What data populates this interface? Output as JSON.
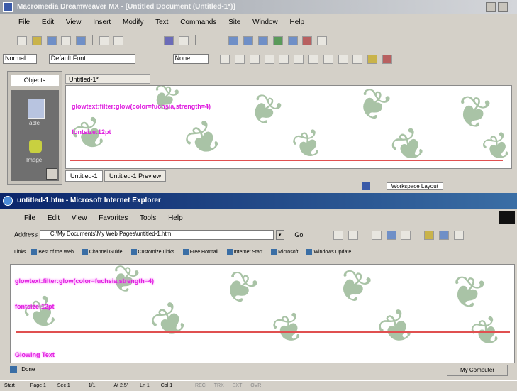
{
  "dw_window": {
    "title": "Macromedia Dreamweaver MX - [Untitled Document (Untitled-1*)]",
    "menu": [
      "File",
      "Edit",
      "View",
      "Insert",
      "Modify",
      "Text",
      "Commands",
      "Site",
      "Window",
      "Help"
    ],
    "properties": {
      "format_value": "Normal",
      "font_value": "Default Font",
      "size_value": "None"
    },
    "doc_tab": "Untitled-1*",
    "panel_label": "Objects",
    "panel_icons": [
      {
        "name": "layout-icon",
        "label": "Table"
      },
      {
        "name": "image-icon",
        "label": "Image"
      }
    ],
    "content_text_1": "glowtext:filter:glow(color=fuchsia,strength=4)",
    "content_text_2": "fontsize:12pt",
    "status_tabs": [
      "Untitled-1",
      "Untitled-1 Preview"
    ],
    "status_right": "Workspace Layout"
  },
  "ie_window": {
    "title": "untitled-1.htm - Microsoft Internet Explorer",
    "menu": [
      "File",
      "Edit",
      "View",
      "Favorites",
      "Tools",
      "Help"
    ],
    "address_label": "Address",
    "address_value": "C:\\My Documents\\My Web Pages\\untitled-1.htm",
    "go_label": "Go",
    "links_label": "Links",
    "links": [
      "Best of the Web",
      "Channel Guide",
      "Customize Links",
      "Free Hotmail",
      "Internet Start",
      "Microsoft",
      "Windows Update"
    ],
    "content_text_1": "glowtext:filter:glow(color=fuchsia,strength=4)",
    "content_text_2": "fontsize:12pt",
    "content_text_3": "Glowing Text",
    "status_left": "Done",
    "status_right": "My Computer"
  },
  "taskbar": {
    "items": [
      "Start",
      "Page 1",
      "Sec 1",
      "1/1",
      "At 2.5\"",
      "Ln 1",
      "Col 1",
      "REC",
      "TRK",
      "EXT",
      "OVR"
    ]
  },
  "colors": {
    "ie_titlebar": "#0a246a",
    "glow_text": "#e020e0",
    "rule_line": "#e05050",
    "leaf": "#a9c3a6"
  }
}
